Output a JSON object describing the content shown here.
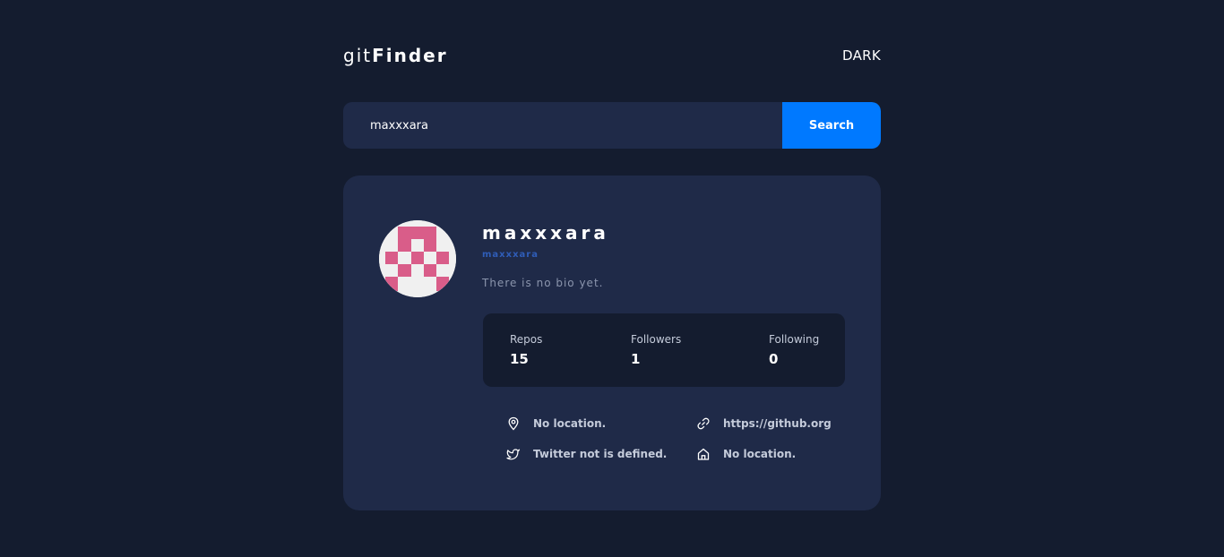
{
  "header": {
    "logo_part1": "git",
    "logo_part2": "Finder",
    "theme_toggle": "DARK"
  },
  "search": {
    "value": "maxxxara",
    "button_label": "Search"
  },
  "profile": {
    "name": "maxxxara",
    "login": "maxxxara",
    "bio": "There is no bio yet.",
    "stats": [
      {
        "label": "Repos",
        "value": "15"
      },
      {
        "label": "Followers",
        "value": "1"
      },
      {
        "label": "Following",
        "value": "0"
      }
    ],
    "info": {
      "location": "No location.",
      "blog": "https://github.org",
      "twitter": "Twitter not is defined.",
      "company": "No location."
    }
  },
  "colors": {
    "background": "#141c2f",
    "card": "#1f2a48",
    "accent": "#0079ff",
    "avatar_pattern": "#d95d89"
  }
}
